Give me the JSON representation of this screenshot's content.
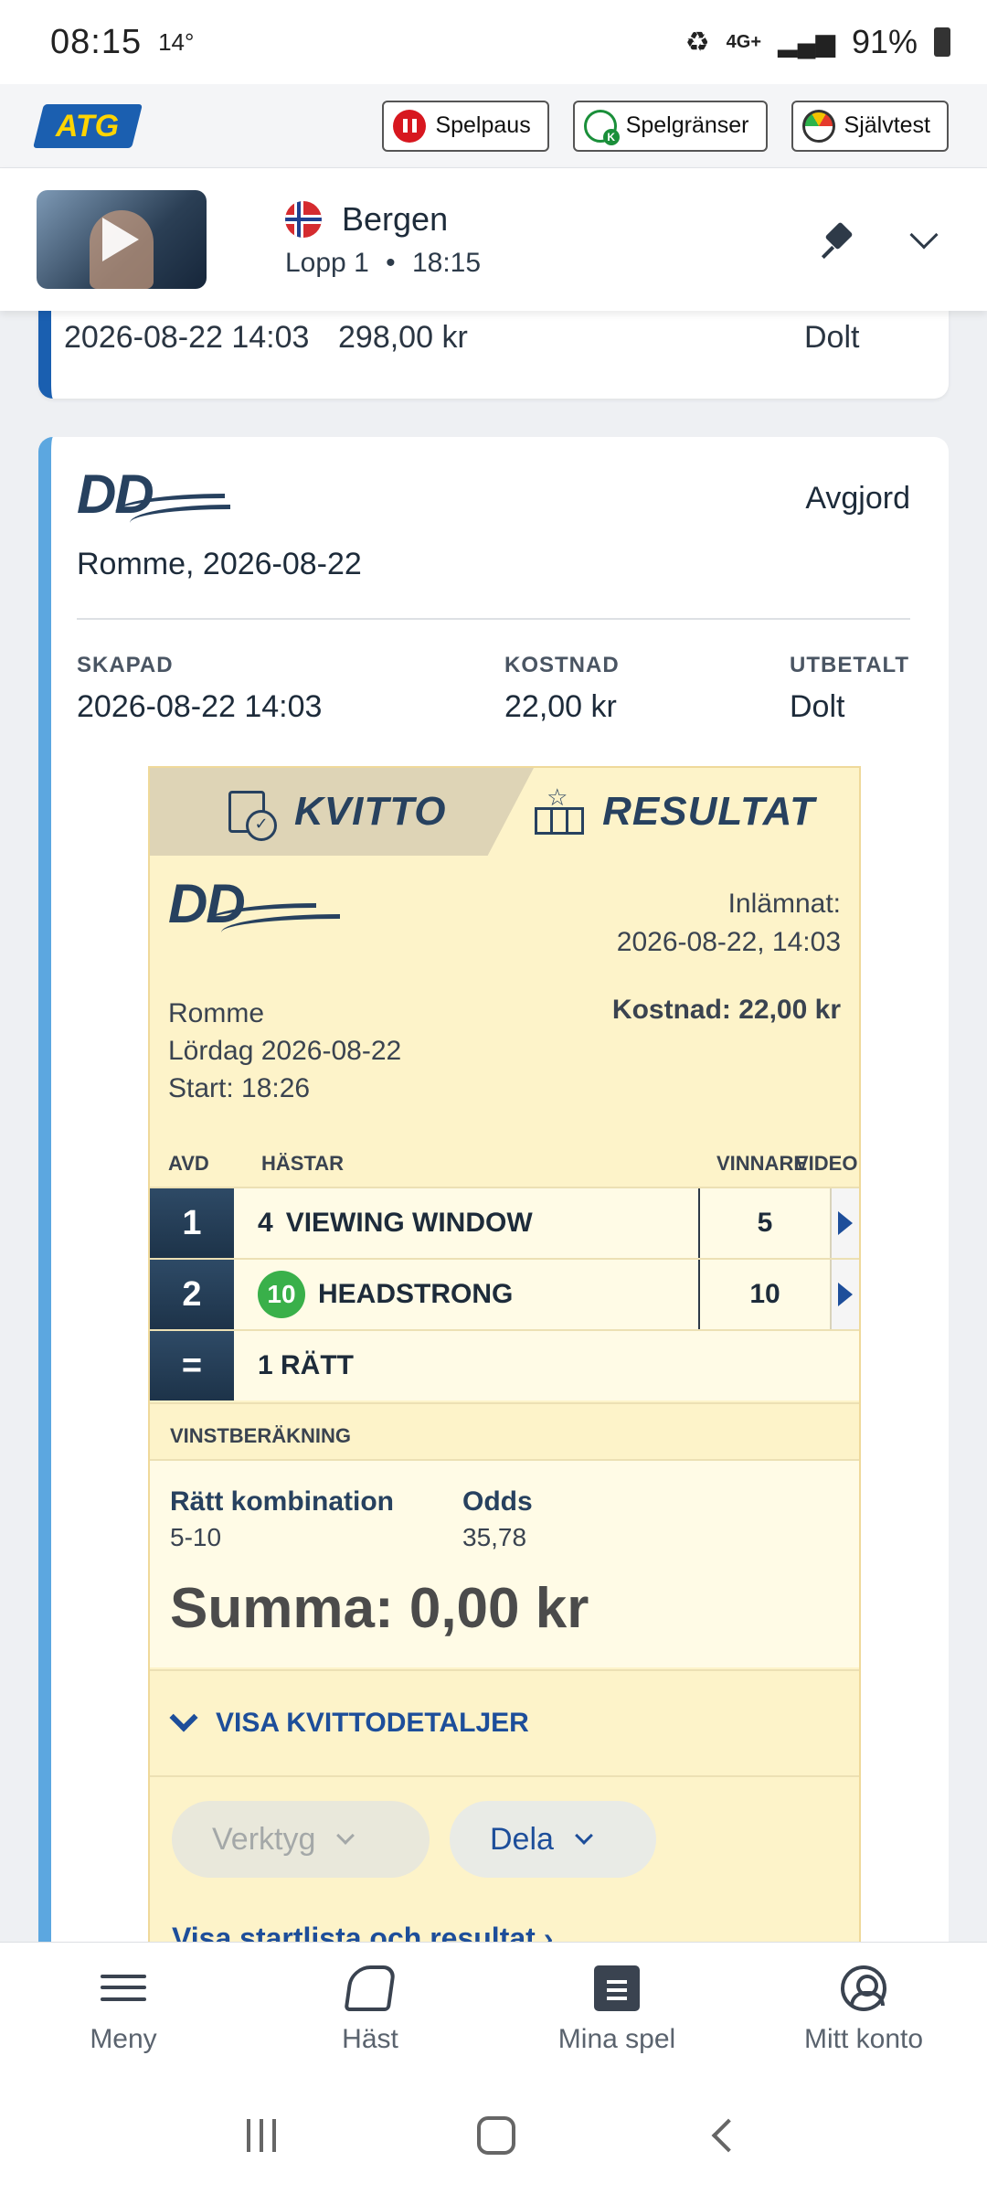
{
  "status_bar": {
    "time": "08:15",
    "temperature": "14°",
    "network": "4G+",
    "battery": "91%"
  },
  "header": {
    "logo": "ATG",
    "buttons": [
      {
        "label": "Spelpaus",
        "icon": "pause-icon"
      },
      {
        "label": "Spelgränser",
        "icon": "limits-icon"
      },
      {
        "label": "Självtest",
        "icon": "gauge-icon"
      }
    ]
  },
  "live_race": {
    "track": "Bergen",
    "country_flag": "norway-flag-icon",
    "race": "Lopp 1",
    "separator": "•",
    "time": "18:15"
  },
  "previous_card": {
    "created": "2026-08-22 14:03",
    "cost": "298,00 kr",
    "paid_out": "Dolt"
  },
  "card": {
    "game_logo": "DD",
    "status": "Avgjord",
    "place_date": "Romme, 2026-08-22",
    "meta": [
      {
        "label": "SKAPAD",
        "value": "2026-08-22 14:03"
      },
      {
        "label": "KOSTNAD",
        "value": "22,00 kr"
      },
      {
        "label": "UTBETALT",
        "value": "Dolt"
      }
    ],
    "receipt": {
      "tabs": {
        "kvitto": "KVITTO",
        "resultat": "RESULTAT"
      },
      "logo": "DD",
      "submitted_label": "Inlämnat:",
      "submitted_value": "2026-08-22, 14:03",
      "track": "Romme",
      "date": "Lördag 2026-08-22",
      "start": "Start: 18:26",
      "cost": "Kostnad: 22,00 kr",
      "columns": {
        "avd": "AVD",
        "hastar": "HÄSTAR",
        "vinnare": "VINNARE",
        "video": "VIDEO"
      },
      "rows": [
        {
          "avd": "1",
          "horse_number": "4",
          "horse_name": "VIEWING WINDOW",
          "winner": "5"
        },
        {
          "avd": "2",
          "horse_number": "10",
          "horse_name": "HEADSTRONG",
          "winner": "10"
        }
      ],
      "total": {
        "symbol": "=",
        "label": "1 RÄTT"
      },
      "calc_header": "VINSTBERÄKNING",
      "calc": {
        "combo_label": "Rätt kombination",
        "combo_value": "5-10",
        "odds_label": "Odds",
        "odds_value": "35,78",
        "sum": "Summa: 0,00 kr"
      },
      "details_link": "VISA KVITTODETALJER",
      "tool_button": "Verktyg",
      "share_button": "Dela",
      "startlist_link": "Visa startlista och resultat ›"
    }
  },
  "bottom_nav": [
    {
      "label": "Meny",
      "icon": "menu-icon"
    },
    {
      "label": "Häst",
      "icon": "horse-icon"
    },
    {
      "label": "Mina spel",
      "icon": "my-bets-icon"
    },
    {
      "label": "Mitt konto",
      "icon": "account-icon"
    }
  ]
}
